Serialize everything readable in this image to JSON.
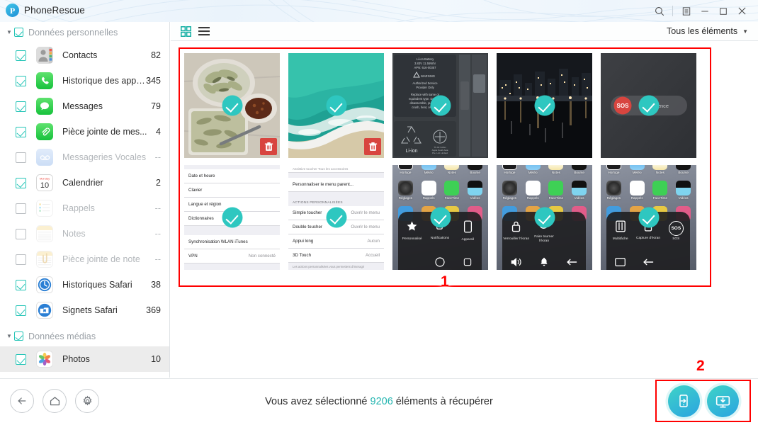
{
  "window": {
    "app_title": "PhoneRescue",
    "logo_icon": "phonerescue-logo-icon",
    "search_icon": "search-icon",
    "menu_icon": "menu-icon",
    "minimize_icon": "minimize-icon",
    "maximize_icon": "maximize-icon",
    "close_icon": "close-icon"
  },
  "sidebar": {
    "groups": [
      {
        "label": "Données personnelles",
        "checked": true,
        "expanded": true,
        "items": [
          {
            "label": "Contacts",
            "count": "82",
            "checked": true,
            "enabled": true,
            "icon": "contacts-icon"
          },
          {
            "label": "Historique des appels",
            "count": "345",
            "checked": true,
            "enabled": true,
            "icon": "phone-icon"
          },
          {
            "label": "Messages",
            "count": "79",
            "checked": true,
            "enabled": true,
            "icon": "messages-icon"
          },
          {
            "label": "Pièce jointe de mes...",
            "count": "4",
            "checked": true,
            "enabled": true,
            "icon": "message-attachment-icon"
          },
          {
            "label": "Messageries Vocales",
            "count": "--",
            "checked": false,
            "enabled": false,
            "icon": "voicemail-icon"
          },
          {
            "label": "Calendrier",
            "count": "2",
            "checked": true,
            "enabled": true,
            "icon": "calendar-icon"
          },
          {
            "label": "Rappels",
            "count": "--",
            "checked": false,
            "enabled": false,
            "icon": "reminders-icon"
          },
          {
            "label": "Notes",
            "count": "--",
            "checked": false,
            "enabled": false,
            "icon": "notes-icon"
          },
          {
            "label": "Pièce jointe de note",
            "count": "--",
            "checked": false,
            "enabled": false,
            "icon": "note-attachment-icon"
          },
          {
            "label": "Historiques Safari",
            "count": "38",
            "checked": true,
            "enabled": true,
            "icon": "safari-history-icon"
          },
          {
            "label": "Signets Safari",
            "count": "369",
            "checked": true,
            "enabled": true,
            "icon": "safari-bookmarks-icon"
          }
        ]
      },
      {
        "label": "Données médias",
        "checked": true,
        "expanded": true,
        "items": [
          {
            "label": "Photos",
            "count": "10",
            "checked": true,
            "enabled": true,
            "selected": true,
            "icon": "photos-icon"
          }
        ]
      }
    ]
  },
  "toolbar": {
    "grid_view_icon": "grid-view-icon",
    "list_view_icon": "list-view-icon",
    "grid_view_active": true,
    "filter_label": "Tous les éléments",
    "filter_caret_icon": "chevron-down-icon"
  },
  "gallery": {
    "annotation": "1",
    "items": [
      {
        "id": "thumb-1",
        "kind": "photo-food",
        "selected": true,
        "deletable": true,
        "delete_icon": "trash-icon"
      },
      {
        "id": "thumb-2",
        "kind": "photo-beach",
        "selected": true,
        "deletable": true,
        "delete_icon": "trash-icon"
      },
      {
        "id": "thumb-3",
        "kind": "photo-battery",
        "selected": true,
        "deletable": false,
        "texts": [
          "Li-ion Battery",
          "3.83V 11.55Whr",
          "APN: 616-00357",
          "WARNING",
          "Authorized Service Provider Only",
          "Replace with same or equivalent type. Do NOT disassemble, puncture, crush, heat, or burn.",
          "Li-ion"
        ]
      },
      {
        "id": "thumb-4",
        "kind": "photo-city-night",
        "selected": true,
        "deletable": false
      },
      {
        "id": "thumb-5",
        "kind": "photo-sos-slider",
        "selected": true,
        "deletable": false,
        "texts": [
          "SOS",
          "Urgence"
        ]
      },
      {
        "id": "thumb-6",
        "kind": "screenshot-ios-settings",
        "selected": true,
        "deletable": false,
        "rows": [
          {
            "label": "Date et heure",
            "value": ""
          },
          {
            "label": "Clavier",
            "value": ""
          },
          {
            "label": "Langue et région",
            "value": ""
          },
          {
            "label": "Dictionnaires",
            "value": ""
          },
          {
            "label": "Synchronisation WLAN iTunes",
            "value": ""
          },
          {
            "label": "VPN",
            "value": "Non connecté"
          }
        ]
      },
      {
        "id": "thumb-7",
        "kind": "screenshot-ios-assistive-settings",
        "selected": true,
        "deletable": false,
        "top_row": "Personnaliser le menu parent...",
        "section": "ACTIONS PERSONNALISÉES",
        "rows": [
          {
            "label": "Simple toucher",
            "value": "Ouvrir le menu"
          },
          {
            "label": "Double toucher",
            "value": "Ouvrir le menu"
          },
          {
            "label": "Appui long",
            "value": "Aucun"
          },
          {
            "label": "3D Touch",
            "value": "Accueil"
          }
        ],
        "footer": "Les actions personnalisées vous permettent d'interagir"
      },
      {
        "id": "thumb-8",
        "kind": "screenshot-ios-homescreen-assistivetouch",
        "selected": true,
        "deletable": false,
        "app_labels": [
          "Horloge",
          "Météo",
          "Notes",
          "Bourse",
          "Réglages",
          "Rappels",
          "FaceTime",
          "Vidéos"
        ],
        "menu_labels": [
          "Personnalisé",
          "Notifications",
          "Appareil"
        ]
      },
      {
        "id": "thumb-9",
        "kind": "screenshot-ios-homescreen-device",
        "selected": true,
        "deletable": false,
        "app_labels": [
          "Horloge",
          "Météo",
          "Notes",
          "Bourse",
          "Réglages",
          "Rappels",
          "FaceTime",
          "Vidéos"
        ],
        "menu_labels": [
          "Verrouiller l'écran",
          "Faire tourner l'écran"
        ]
      },
      {
        "id": "thumb-10",
        "kind": "screenshot-ios-homescreen-more",
        "selected": true,
        "deletable": false,
        "app_labels": [
          "Horloge",
          "Météo",
          "Notes",
          "Bourse",
          "Réglages",
          "Rappels",
          "FaceTime",
          "Vidéos"
        ],
        "menu_labels": [
          "Multitâche",
          "Capture d'écran",
          "SOS"
        ]
      }
    ]
  },
  "footer": {
    "back_icon": "back-arrow-icon",
    "home_icon": "home-icon",
    "settings_icon": "gear-icon",
    "status_prefix": "Vous avez sélectionné",
    "status_count": "9206",
    "status_suffix": "éléments à récupérer",
    "annotation": "2",
    "actions": [
      {
        "name": "recover-to-device-button",
        "icon": "phone-export-icon"
      },
      {
        "name": "recover-to-computer-button",
        "icon": "computer-download-icon"
      }
    ]
  },
  "colors": {
    "accent_teal": "#23c4b6",
    "check_teal": "#2ec7c0",
    "annotation_red": "#ff0000",
    "delete_red": "#d8453f",
    "status_num": "#23b5b0"
  }
}
